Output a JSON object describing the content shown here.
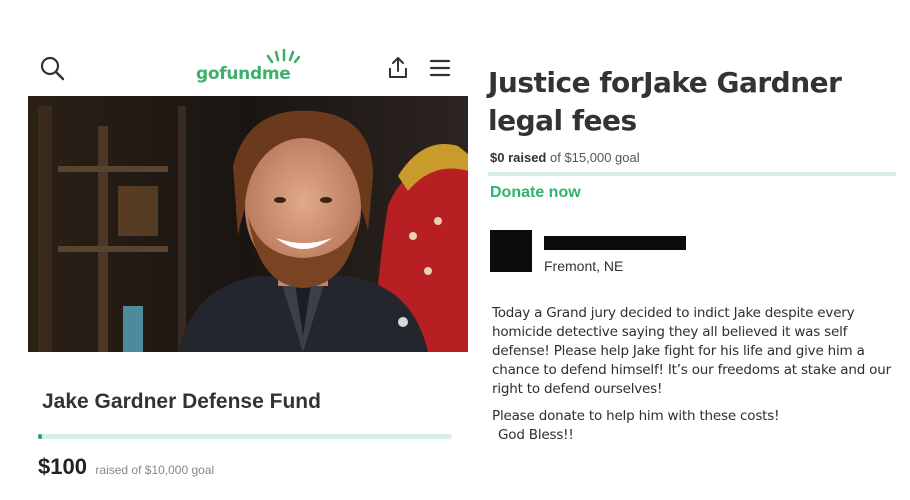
{
  "left_card": {
    "logo_text": "gofundme",
    "fund_title": "Jake Gardner Defense Fund",
    "raised_amount": "$100",
    "raised_suffix": "raised of $10,000 goal",
    "progress_fraction": 0.01,
    "icons": {
      "search": "search-icon",
      "share": "share-icon",
      "menu": "hamburger-menu-icon",
      "photo": "campaign-photo"
    }
  },
  "right_card": {
    "title": "Justice forJake Gardner legal fees",
    "raised_amount": "$0 raised",
    "raised_suffix": " of $15,000 goal",
    "progress_fraction": 0.0,
    "donate_label": "Donate now",
    "organizer_location": "Fremont, NE",
    "story_paragraph_1": "Today a Grand jury decided to indict Jake despite every homicide detective saying they all believed it was self defense! Please help Jake fight for his life and give him a chance to defend himself! It’s our freedoms at stake and our right to defend ourselves!",
    "story_paragraph_2_line_1": "Please donate to help him with these costs!",
    "story_paragraph_2_line_2": "God Bless!!"
  },
  "colors": {
    "brand_green": "#2fb36d",
    "progress_track": "#d7efe3",
    "progress_fill": "#23a46a"
  }
}
